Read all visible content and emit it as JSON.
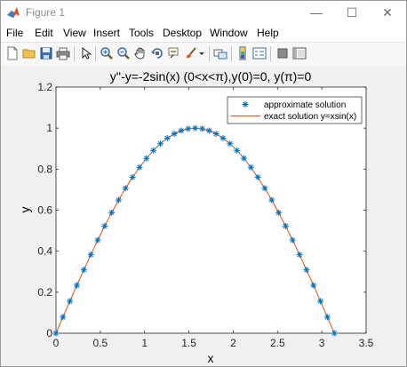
{
  "window": {
    "title": "Figure 1",
    "minimize": "—",
    "maximize": "☐",
    "close": "✕"
  },
  "menu": {
    "items": [
      {
        "label": "File"
      },
      {
        "label": "Edit"
      },
      {
        "label": "View"
      },
      {
        "label": "Insert"
      },
      {
        "label": "Tools"
      },
      {
        "label": "Desktop"
      },
      {
        "label": "Window"
      },
      {
        "label": "Help"
      }
    ]
  },
  "toolbar": {
    "icons": [
      "new-figure-icon",
      "open-file-icon",
      "save-icon",
      "print-icon",
      "select-arrow-icon",
      "zoom-in-icon",
      "zoom-out-icon",
      "pan-hand-icon",
      "rotate-3d-icon",
      "data-cursor-icon",
      "brush-icon",
      "brush-dropdown-icon",
      "link-plot-icon",
      "insert-colorbar-icon",
      "insert-legend-icon",
      "hide-plot-tools-icon",
      "show-plot-tools-icon"
    ]
  },
  "chart_data": {
    "type": "line",
    "title": "y''-y=-2sin(x) (0<x<π),y(0)=0, y(π)=0",
    "xlabel": "x",
    "ylabel": "y",
    "xlim": [
      0,
      3.5
    ],
    "ylim": [
      0,
      1.2
    ],
    "xticks": [
      "0",
      "0.5",
      "1",
      "1.5",
      "2",
      "2.5",
      "3",
      "3.5"
    ],
    "yticks": [
      "0",
      "0.2",
      "0.4",
      "0.6",
      "0.8",
      "1",
      "1.2"
    ],
    "grid": false,
    "legend_position": "top-right",
    "series": [
      {
        "name": "approximate solution",
        "style": "markers",
        "marker": "asterisk",
        "color": "#0072BD",
        "x": [
          0,
          0.0785,
          0.1571,
          0.2356,
          0.3142,
          0.3927,
          0.4712,
          0.5498,
          0.6283,
          0.7069,
          0.7854,
          0.8639,
          0.9425,
          1.021,
          1.0996,
          1.1781,
          1.2566,
          1.3352,
          1.4137,
          1.4923,
          1.5708,
          1.6493,
          1.7279,
          1.8064,
          1.885,
          1.9635,
          2.042,
          2.1206,
          2.1991,
          2.2777,
          2.3562,
          2.4347,
          2.5133,
          2.5918,
          2.6704,
          2.7489,
          2.8274,
          2.906,
          2.9845,
          3.0631,
          3.1416
        ],
        "y": [
          0,
          0.0785,
          0.1564,
          0.2334,
          0.309,
          0.3827,
          0.454,
          0.5225,
          0.5878,
          0.6494,
          0.7071,
          0.7604,
          0.809,
          0.8526,
          0.891,
          0.9239,
          0.9511,
          0.9724,
          0.9877,
          0.9969,
          1.0,
          0.9969,
          0.9877,
          0.9724,
          0.9511,
          0.9239,
          0.891,
          0.8526,
          0.809,
          0.7604,
          0.7071,
          0.6494,
          0.5878,
          0.5225,
          0.454,
          0.3827,
          0.309,
          0.2334,
          0.1564,
          0.0785,
          0
        ]
      },
      {
        "name": "exact solution y=xsin(x)",
        "style": "line",
        "color": "#D95319",
        "x": [
          0,
          0.0785,
          0.1571,
          0.2356,
          0.3142,
          0.3927,
          0.4712,
          0.5498,
          0.6283,
          0.7069,
          0.7854,
          0.8639,
          0.9425,
          1.021,
          1.0996,
          1.1781,
          1.2566,
          1.3352,
          1.4137,
          1.4923,
          1.5708,
          1.6493,
          1.7279,
          1.8064,
          1.885,
          1.9635,
          2.042,
          2.1206,
          2.1991,
          2.2777,
          2.3562,
          2.4347,
          2.5133,
          2.5918,
          2.6704,
          2.7489,
          2.8274,
          2.906,
          2.9845,
          3.0631,
          3.1416
        ],
        "y": [
          0,
          0.0785,
          0.1564,
          0.2334,
          0.309,
          0.3827,
          0.454,
          0.5225,
          0.5878,
          0.6494,
          0.7071,
          0.7604,
          0.809,
          0.8526,
          0.891,
          0.9239,
          0.9511,
          0.9724,
          0.9877,
          0.9969,
          1.0,
          0.9969,
          0.9877,
          0.9724,
          0.9511,
          0.9239,
          0.891,
          0.8526,
          0.809,
          0.7604,
          0.7071,
          0.6494,
          0.5878,
          0.5225,
          0.454,
          0.3827,
          0.309,
          0.2334,
          0.1564,
          0.0785,
          0
        ]
      }
    ]
  }
}
